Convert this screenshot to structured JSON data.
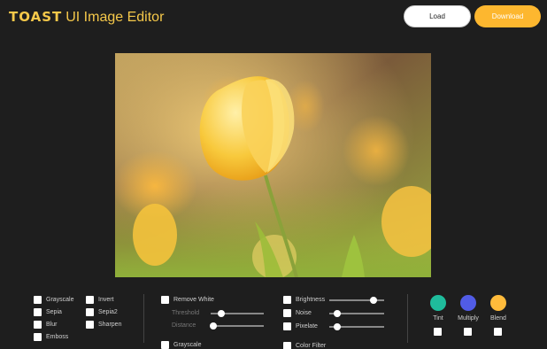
{
  "header": {
    "logo_bold": "TOAST",
    "logo_text": "UI Image Editor",
    "load_label": "Load",
    "download_label": "Download"
  },
  "filters": {
    "col1": [
      "Grayscale",
      "Sepia",
      "Blur",
      "Emboss"
    ],
    "col2": [
      "Invert",
      "Sepia2",
      "Sharpen"
    ],
    "remove_white": "Remove White",
    "threshold": "Threshold",
    "distance": "Distance",
    "grayscale2": "Grayscale",
    "brightness": "Brightness",
    "noise": "Noise",
    "pixelate": "Pixelate",
    "color_filter": "Color Filter",
    "tint": "Tint",
    "multiply": "Multiply",
    "blend": "Blend"
  },
  "colors": {
    "accent": "#fdb72f",
    "tint": "#1fbc9c",
    "multiply": "#515ce6",
    "blend": "#ffbb3b"
  },
  "slider_levels": {
    "threshold": 0.2,
    "distance": 0.05,
    "brightness": 0.8,
    "noise": 0.15,
    "pixelate": 0.15
  }
}
